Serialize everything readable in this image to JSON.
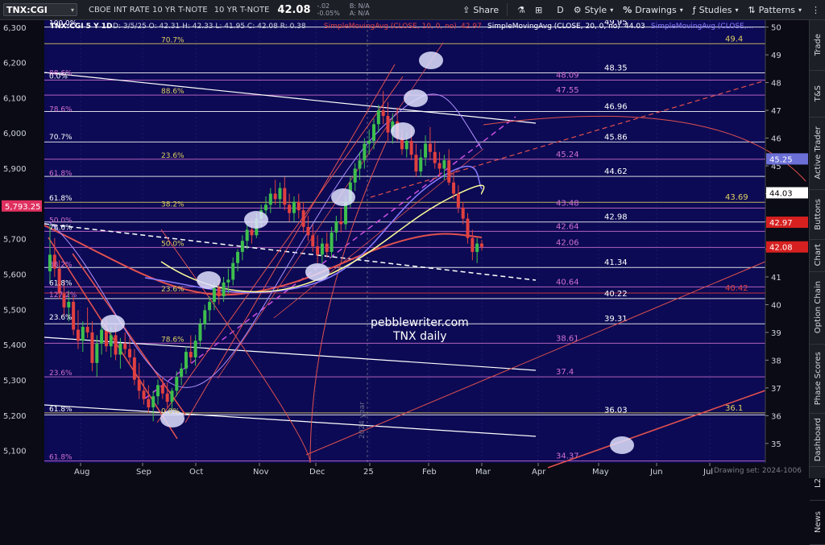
{
  "toolbar": {
    "symbol": "TNX:CGI",
    "description": "CBOE INT RATE 10 YR T-NOTE",
    "description2": "10 YR T-NOTE",
    "last": "42.08",
    "change": "-.02",
    "change_pct": "-0.05%",
    "bid": "B: N/A",
    "ask": "A: N/A",
    "share_label": "Share",
    "interval_label": "D",
    "style_label": "Style",
    "drawings_label": "Drawings",
    "studies_label": "Studies",
    "patterns_label": "Patterns"
  },
  "legend": {
    "header": "TNX:CGI 5 Y 1D",
    "ohlc": "D: 3/5/25  O: 42.31  H: 42.33  L: 41.95  C: 42.08  R: 0.38",
    "sma10": "SimpleMovingAvg (CLOSE, 10, 0, no)",
    "sma10_value": "42.97",
    "sma20": "SimpleMovingAvg (CLOSE, 20, 0, no)",
    "sma20_value": "44.03",
    "sma50": "SimpleMovingAvg (CLOSE,..."
  },
  "watermark": {
    "line1": "pebblewriter.com",
    "line2": "TNX daily"
  },
  "vertical_label": "2024 year",
  "drawing_set": "Drawing set: 2024-1006",
  "left_axis_marker": "5,793.25",
  "right_markers": [
    {
      "label": "45.25",
      "color": "#6b6fd6",
      "text_color": "#ffffff"
    },
    {
      "label": "44.03",
      "color": "#ffffff",
      "text_color": "#000000"
    },
    {
      "label": "42.97",
      "color": "#d62020",
      "text_color": "#ffffff"
    },
    {
      "label": "42.08",
      "color": "#d62020",
      "text_color": "#ffffff"
    }
  ],
  "right_tabs": [
    "Trade",
    "T&S",
    "Active Trader",
    "Buttons",
    "Chart",
    "Option Chain",
    "Phase Scores",
    "Dashboard",
    "L2",
    "News"
  ],
  "fib_labels": [
    {
      "text": "100.0%",
      "v": 50.0
    },
    {
      "text": "70.7%",
      "v": 49.4
    },
    {
      "text": "88.6%",
      "v": 48.2
    },
    {
      "text": "0.0%",
      "v": 48.09
    },
    {
      "text": "88.6%",
      "v": 47.55
    },
    {
      "text": "78.6%",
      "v": 46.9
    },
    {
      "text": "70.7%",
      "v": 45.9
    },
    {
      "text": "23.6%",
      "v": 45.24
    },
    {
      "text": "61.8%",
      "v": 44.6
    },
    {
      "text": "61.8%",
      "v": 43.69
    },
    {
      "text": "38.2%",
      "v": 43.48
    },
    {
      "text": "50.0%",
      "v": 42.9
    },
    {
      "text": "78.6%",
      "v": 42.64
    },
    {
      "text": "50.0%",
      "v": 42.06
    },
    {
      "text": "38.2%",
      "v": 41.3
    },
    {
      "text": "61.8%",
      "v": 40.64
    },
    {
      "text": "23.6%",
      "v": 40.42
    },
    {
      "text": "127.2%",
      "v": 40.22
    },
    {
      "text": "23.6%",
      "v": 39.4
    },
    {
      "text": "78.6%",
      "v": 38.61
    },
    {
      "text": "23.6%",
      "v": 37.4
    },
    {
      "text": "61.8%",
      "v": 36.1
    },
    {
      "text": "0.0%",
      "v": 36.03
    },
    {
      "text": "61.8%",
      "v": 34.37
    }
  ],
  "chart_data": {
    "type": "candlestick",
    "symbol": "TNX:CGI",
    "x_tick_labels": [
      "Aug",
      "Sep",
      "Oct",
      "Nov",
      "Dec",
      "25",
      "Feb",
      "Mar",
      "Apr",
      "May",
      "Jun",
      "Jul"
    ],
    "left_axis": {
      "ticks": [
        "6,300",
        "6,200",
        "6,100",
        "6,000",
        "5,900",
        "5,800",
        "5,700",
        "5,600",
        "5,500",
        "5,400",
        "5,300",
        "5,200",
        "5,100"
      ],
      "range": [
        5065,
        6320
      ]
    },
    "right_axis": {
      "ticks": [
        50,
        49,
        48,
        47,
        46,
        45,
        44,
        43,
        42,
        41,
        40,
        39,
        38,
        37,
        36,
        35
      ],
      "range": [
        34.3,
        50.25
      ]
    },
    "horizontal_levels": [
      {
        "value": 50.0,
        "label": "49.95",
        "color": "#ffffff"
      },
      {
        "value": 49.4,
        "label": "49.4",
        "color": "#e0d060"
      },
      {
        "value": 48.35,
        "label": "48.35",
        "color": "#ffffff"
      },
      {
        "value": 48.09,
        "label": "48.09",
        "color": "#d070d0"
      },
      {
        "value": 47.55,
        "label": "47.55",
        "color": "#d070d0"
      },
      {
        "value": 46.96,
        "label": "46.96",
        "color": "#ffffff"
      },
      {
        "value": 45.86,
        "label": "45.86",
        "color": "#ffffff"
      },
      {
        "value": 45.24,
        "label": "45.24",
        "color": "#d070d0"
      },
      {
        "value": 44.62,
        "label": "44.62",
        "color": "#ffffff"
      },
      {
        "value": 43.69,
        "label": "43.69",
        "color": "#e0d060"
      },
      {
        "value": 43.48,
        "label": "43.48",
        "color": "#d070d0"
      },
      {
        "value": 42.98,
        "label": "42.98",
        "color": "#ffffff"
      },
      {
        "value": 42.64,
        "label": "42.64",
        "color": "#d070d0"
      },
      {
        "value": 42.06,
        "label": "42.06",
        "color": "#d070d0"
      },
      {
        "value": 41.34,
        "label": "41.34",
        "color": "#ffffff"
      },
      {
        "value": 40.64,
        "label": "40.64",
        "color": "#d070d0"
      },
      {
        "value": 40.42,
        "label": "40.42",
        "color": "#e04040"
      },
      {
        "value": 40.22,
        "label": "40.22",
        "color": "#ffffff"
      },
      {
        "value": 39.31,
        "label": "39.31",
        "color": "#ffffff"
      },
      {
        "value": 38.61,
        "label": "38.61",
        "color": "#d070d0"
      },
      {
        "value": 37.4,
        "label": "37.4",
        "color": "#d070d0"
      },
      {
        "value": 36.1,
        "label": "36.1",
        "color": "#e0d060"
      },
      {
        "value": 36.03,
        "label": "36.03",
        "color": "#ffffff"
      },
      {
        "value": 34.37,
        "label": "34.37",
        "color": "#d070d0"
      }
    ],
    "candles_ohlc": [
      [
        41.2,
        42.9,
        40.8,
        41.8
      ],
      [
        41.8,
        42.4,
        41.0,
        41.3
      ],
      [
        41.3,
        41.6,
        40.2,
        40.4
      ],
      [
        40.4,
        40.9,
        39.6,
        39.9
      ],
      [
        39.9,
        40.5,
        39.4,
        40.1
      ],
      [
        40.1,
        40.3,
        38.9,
        39.1
      ],
      [
        39.1,
        39.8,
        38.4,
        38.7
      ],
      [
        38.7,
        39.4,
        38.3,
        39.2
      ],
      [
        39.2,
        39.9,
        38.8,
        39.0
      ],
      [
        39.0,
        39.4,
        37.6,
        37.9
      ],
      [
        37.9,
        38.9,
        37.4,
        38.6
      ],
      [
        38.6,
        39.4,
        38.2,
        39.1
      ],
      [
        39.1,
        39.5,
        38.3,
        38.5
      ],
      [
        38.5,
        39.2,
        38.1,
        38.9
      ],
      [
        38.9,
        39.3,
        38.0,
        38.2
      ],
      [
        38.2,
        38.8,
        37.7,
        38.6
      ],
      [
        38.6,
        39.0,
        38.2,
        38.4
      ],
      [
        38.4,
        38.8,
        37.9,
        38.1
      ],
      [
        38.1,
        38.4,
        37.1,
        37.3
      ],
      [
        37.3,
        37.9,
        36.6,
        36.9
      ],
      [
        36.9,
        37.3,
        36.4,
        36.6
      ],
      [
        36.6,
        37.1,
        36.1,
        36.3
      ],
      [
        36.3,
        36.9,
        35.8,
        36.7
      ],
      [
        36.7,
        37.3,
        36.4,
        37.1
      ],
      [
        37.1,
        37.4,
        36.6,
        36.8
      ],
      [
        36.8,
        37.2,
        36.3,
        36.5
      ],
      [
        36.5,
        37.0,
        36.2,
        36.9
      ],
      [
        36.9,
        37.6,
        36.7,
        37.4
      ],
      [
        37.4,
        37.9,
        37.1,
        37.7
      ],
      [
        37.7,
        38.5,
        37.5,
        38.3
      ],
      [
        38.3,
        38.9,
        37.9,
        38.1
      ],
      [
        38.1,
        38.9,
        37.8,
        38.7
      ],
      [
        38.7,
        39.5,
        38.5,
        39.3
      ],
      [
        39.3,
        40.0,
        39.1,
        39.8
      ],
      [
        39.8,
        40.3,
        39.4,
        40.1
      ],
      [
        40.1,
        40.8,
        39.8,
        40.6
      ],
      [
        40.6,
        40.9,
        40.0,
        40.3
      ],
      [
        40.3,
        41.0,
        40.1,
        40.8
      ],
      [
        40.8,
        41.3,
        40.4,
        40.9
      ],
      [
        40.9,
        41.7,
        40.7,
        41.5
      ],
      [
        41.5,
        42.0,
        41.2,
        41.9
      ],
      [
        41.9,
        42.5,
        41.6,
        42.3
      ],
      [
        42.3,
        42.9,
        42.0,
        42.7
      ],
      [
        42.7,
        43.1,
        42.2,
        42.5
      ],
      [
        42.5,
        43.3,
        42.4,
        43.1
      ],
      [
        43.1,
        43.6,
        42.8,
        43.4
      ],
      [
        43.4,
        43.9,
        43.1,
        43.6
      ],
      [
        43.6,
        44.2,
        43.3,
        44.0
      ],
      [
        44.0,
        44.5,
        43.6,
        43.8
      ],
      [
        43.8,
        44.4,
        43.5,
        44.2
      ],
      [
        44.2,
        44.6,
        43.4,
        43.6
      ],
      [
        43.6,
        44.0,
        43.0,
        43.3
      ],
      [
        43.3,
        43.9,
        43.0,
        43.7
      ],
      [
        43.7,
        44.0,
        43.1,
        43.4
      ],
      [
        43.4,
        43.7,
        42.6,
        42.8
      ],
      [
        42.8,
        43.2,
        42.3,
        42.5
      ],
      [
        42.5,
        42.9,
        41.9,
        42.1
      ],
      [
        42.1,
        42.5,
        41.5,
        41.8
      ],
      [
        41.8,
        42.4,
        41.5,
        42.2
      ],
      [
        42.2,
        42.6,
        41.7,
        41.9
      ],
      [
        41.9,
        42.8,
        41.7,
        42.6
      ],
      [
        42.6,
        43.2,
        42.3,
        43.0
      ],
      [
        43.0,
        43.5,
        42.6,
        42.9
      ],
      [
        42.9,
        43.9,
        42.7,
        43.7
      ],
      [
        43.7,
        44.6,
        43.5,
        44.4
      ],
      [
        44.4,
        45.1,
        44.1,
        44.9
      ],
      [
        44.9,
        45.5,
        44.5,
        45.2
      ],
      [
        45.2,
        46.0,
        44.9,
        45.8
      ],
      [
        45.8,
        46.3,
        45.4,
        45.9
      ],
      [
        45.9,
        46.7,
        45.6,
        46.5
      ],
      [
        46.5,
        47.2,
        46.2,
        47.0
      ],
      [
        47.0,
        47.7,
        46.5,
        46.8
      ],
      [
        46.8,
        47.3,
        45.9,
        46.2
      ],
      [
        46.2,
        46.9,
        45.8,
        46.6
      ],
      [
        46.6,
        47.1,
        45.9,
        46.0
      ],
      [
        46.0,
        46.3,
        45.4,
        45.6
      ],
      [
        45.6,
        46.2,
        45.3,
        45.9
      ],
      [
        45.9,
        46.4,
        45.2,
        45.4
      ],
      [
        45.4,
        45.8,
        44.6,
        44.8
      ],
      [
        44.8,
        45.6,
        44.6,
        45.3
      ],
      [
        45.3,
        46.1,
        45.0,
        45.8
      ],
      [
        45.8,
        46.4,
        45.2,
        45.5
      ],
      [
        45.5,
        45.9,
        44.9,
        45.1
      ],
      [
        45.1,
        45.5,
        44.6,
        44.9
      ],
      [
        44.9,
        45.4,
        44.5,
        45.2
      ],
      [
        45.2,
        45.6,
        44.3,
        44.4
      ],
      [
        44.4,
        44.8,
        43.8,
        44.0
      ],
      [
        44.0,
        44.3,
        43.3,
        43.5
      ],
      [
        43.5,
        43.7,
        42.9,
        43.1
      ],
      [
        43.1,
        43.3,
        42.2,
        42.4
      ],
      [
        42.4,
        42.7,
        41.6,
        41.9
      ],
      [
        41.9,
        42.4,
        41.5,
        42.2
      ],
      [
        42.2,
        42.33,
        41.95,
        42.08
      ]
    ]
  }
}
